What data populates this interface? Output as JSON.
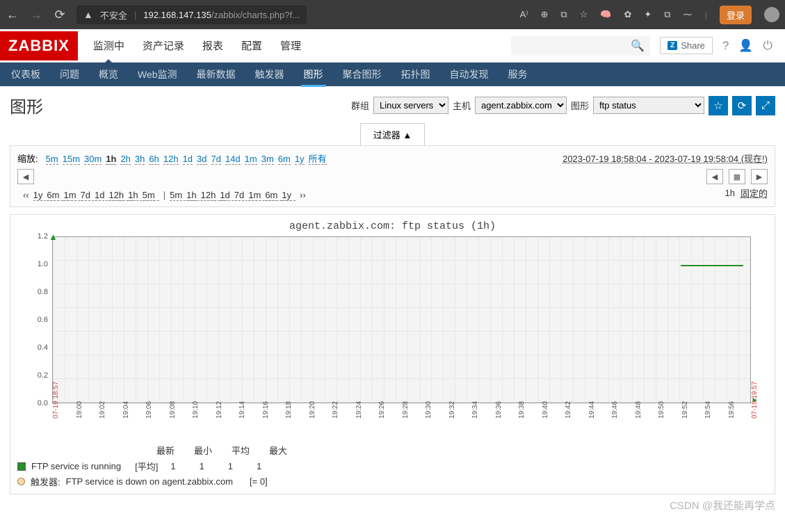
{
  "browser": {
    "insecure": "不安全",
    "url_host": "192.168.147.135",
    "url_path": "/zabbix/charts.php?f...",
    "login": "登录"
  },
  "header": {
    "logo": "ZABBIX",
    "menu": [
      "监测中",
      "资产记录",
      "报表",
      "配置",
      "管理"
    ],
    "menu_active": 0,
    "share": "Share"
  },
  "submenu": {
    "items": [
      "仪表板",
      "问题",
      "概览",
      "Web监测",
      "最新数据",
      "触发器",
      "图形",
      "聚合图形",
      "拓扑图",
      "自动发现",
      "服务"
    ],
    "active": 6
  },
  "page": {
    "title": "图形",
    "group_label": "群组",
    "group_value": "Linux servers",
    "host_label": "主机",
    "host_value": "agent.zabbix.com",
    "graph_label": "图形",
    "graph_value": "ftp status",
    "filter_tab": "过滤器 ▲"
  },
  "timeline": {
    "zoom_label": "缩放:",
    "zoom": [
      "5m",
      "15m",
      "30m",
      "1h",
      "2h",
      "3h",
      "6h",
      "12h",
      "1d",
      "3d",
      "7d",
      "14d",
      "1m",
      "3m",
      "6m",
      "1y",
      "所有"
    ],
    "zoom_active": "1h",
    "start": "2023-07-19 18:58:04",
    "end": "2023-07-19 19:58:04",
    "now": "(现在!)",
    "back": [
      "1y",
      "6m",
      "1m",
      "7d",
      "1d",
      "12h",
      "1h",
      "5m"
    ],
    "fwd": [
      "5m",
      "1h",
      "12h",
      "1d",
      "7d",
      "1m",
      "6m",
      "1y"
    ],
    "fixed_dur": "1h",
    "fixed_label": "固定的"
  },
  "chart_data": {
    "type": "line",
    "title": "agent.zabbix.com: ftp status (1h)",
    "ylim": [
      0,
      1.2
    ],
    "y_ticks": [
      0,
      0.2,
      0.4,
      0.6,
      0.8,
      1.0,
      1.2
    ],
    "x_ticks": [
      "07-19 18:57",
      "19:00",
      "19:02",
      "19:04",
      "19:06",
      "19:08",
      "19:10",
      "19:12",
      "19:14",
      "19:16",
      "19:18",
      "19:20",
      "19:22",
      "19:24",
      "19:26",
      "19:28",
      "19:30",
      "19:32",
      "19:34",
      "19:36",
      "19:38",
      "19:40",
      "19:42",
      "19:44",
      "19:46",
      "19:48",
      "19:50",
      "19:52",
      "19:54",
      "19:56",
      "07-19 19:57"
    ],
    "series": [
      {
        "name": "FTP service is running",
        "color": "#2a8f2a",
        "value": 1,
        "segments": [
          {
            "x_start_pct": 90,
            "x_end_pct": 99,
            "y": 1
          }
        ]
      }
    ],
    "legend_headers": [
      "最新",
      "最小",
      "平均",
      "最大"
    ],
    "legend_row": {
      "name": "FTP service is running",
      "func": "[平均]",
      "values": [
        "1",
        "1",
        "1",
        "1"
      ]
    },
    "trigger_label": "触发器:",
    "trigger_text": "FTP service is down on agent.zabbix.com",
    "trigger_expr": "[= 0]"
  },
  "watermark": "CSDN @我还能再学点"
}
